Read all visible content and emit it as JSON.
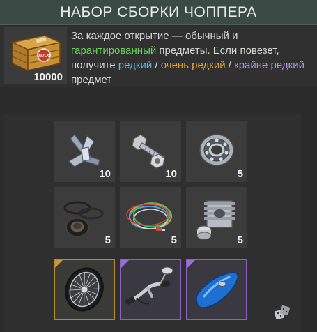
{
  "title": "НАБОР СБОРКИ ЧОППЕРА",
  "crate": {
    "icon": "crate-icon",
    "quantity": "10000",
    "label_art": "MAX"
  },
  "description": {
    "part1": "За каждое открытие — обычный и ",
    "guaranteed": "гарантированный",
    "part2": " предметы. Если повезет, получите ",
    "rare": "редкий",
    "sep1": " / ",
    "very_rare": "очень редкий",
    "sep2": " / ",
    "extremely_rare": "крайне редкий",
    "part3": " предмет"
  },
  "common_items": [
    {
      "icon": "metal-scrap-icon",
      "quantity": "10"
    },
    {
      "icon": "bolt-nut-icon",
      "quantity": "10"
    },
    {
      "icon": "bearing-icon",
      "quantity": "5"
    },
    {
      "icon": "gaskets-icon",
      "quantity": "5"
    },
    {
      "icon": "wires-icon",
      "quantity": "5"
    },
    {
      "icon": "cylinder-piston-icon",
      "quantity": "5"
    }
  ],
  "rare_items": [
    {
      "icon": "wheel-icon",
      "rarity": "very-rare"
    },
    {
      "icon": "handlebar-icon",
      "rarity": "extremely-rare"
    },
    {
      "icon": "fuel-tank-icon",
      "rarity": "extremely-rare"
    }
  ],
  "dice_icon": "dice-icon",
  "colors": {
    "guaranteed": "#6cd35f",
    "rare": "#5bb6e2",
    "very_rare": "#e5a13b",
    "extremely_rare": "#b98ef0"
  }
}
